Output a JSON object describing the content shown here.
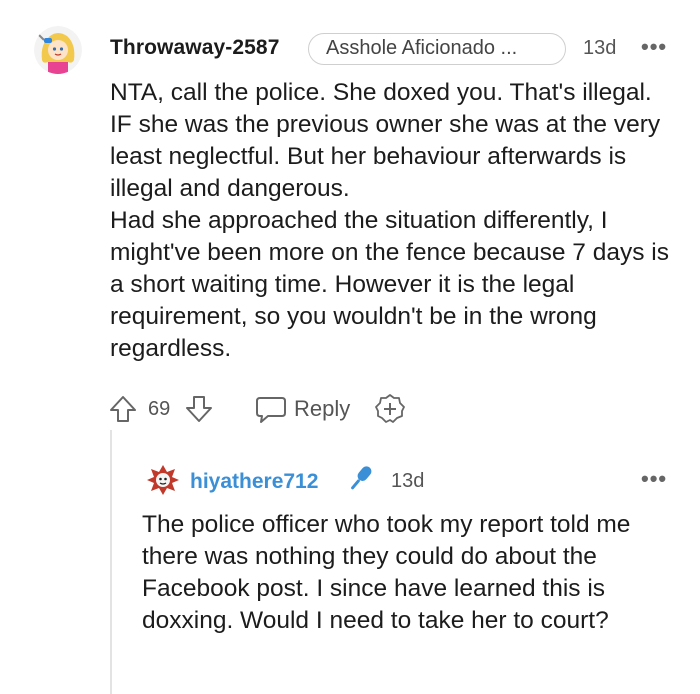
{
  "comment": {
    "author": "Throwaway-2587",
    "flair": "Asshole Aficionado ...",
    "time": "13d",
    "more": "•••",
    "body_paragraphs": [
      "NTA, call the police. She doxed you. That's illegal. IF she was the previous owner she was at the very least neglectful. But her behaviour afterwards is illegal and dangerous.",
      "Had she approached the situation differently, I might've been more on the fence because 7 days is a short waiting time. However it is the legal requirement, so you wouldn't be in the wrong regardless."
    ],
    "votes": "69",
    "reply_label": "Reply"
  },
  "reply": {
    "author": "hiyathere712",
    "time": "13d",
    "more": "•••",
    "body": "The police officer who took my report told me there was nothing they could do about the Facebook post. I since have learned this is doxxing. Would I need to take her to court?"
  },
  "colors": {
    "reply_author": "#3a8fd6",
    "thread_line": "#e3e3e3",
    "mic_badge": "#3a8fd6"
  }
}
